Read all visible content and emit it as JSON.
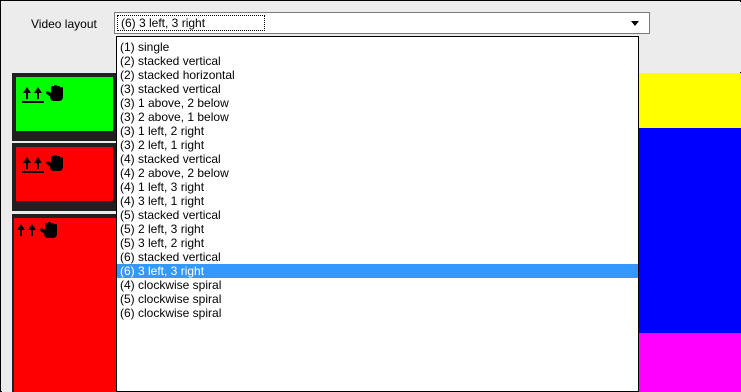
{
  "layout_label": "Video layout",
  "combo": {
    "value": "(6) 3 left, 3 right"
  },
  "dropdown": {
    "items": [
      "(1) single",
      "(2) stacked vertical",
      "(2) stacked horizontal",
      "(3) stacked vertical",
      "(3) 1 above, 2 below",
      "(3) 2 above, 1 below",
      "(3) 1 left, 2 right",
      "(3) 2 left, 1 right",
      "(4) stacked vertical",
      "(4) 2 above, 2 below",
      "(4) 1 left, 3 right",
      "(4) 3 left, 1 right",
      "(5) stacked vertical",
      "(5) 2 left, 3 right",
      "(5) 3 left, 2 right",
      "(6) stacked vertical",
      "(6) 3 left, 3 right",
      "(4) clockwise spiral",
      "(5) clockwise spiral",
      "(6) clockwise spiral"
    ],
    "selected_index": 16
  },
  "panels": {
    "left": [
      {
        "color": "#00ff00",
        "icons": [
          "up-arrow-icon",
          "up-arrow-icon",
          "hand-icon"
        ]
      },
      {
        "color": "#ff0000",
        "icons": [
          "up-arrow-icon",
          "up-arrow-icon",
          "hand-icon"
        ]
      },
      {
        "color": "#ff0000",
        "icons": [
          "up-arrow-icon",
          "up-arrow-icon",
          "hand-icon"
        ]
      }
    ],
    "right": [
      {
        "color": "#ffff00"
      },
      {
        "color": "#0000ff"
      },
      {
        "color": "#ff00ff"
      }
    ]
  }
}
